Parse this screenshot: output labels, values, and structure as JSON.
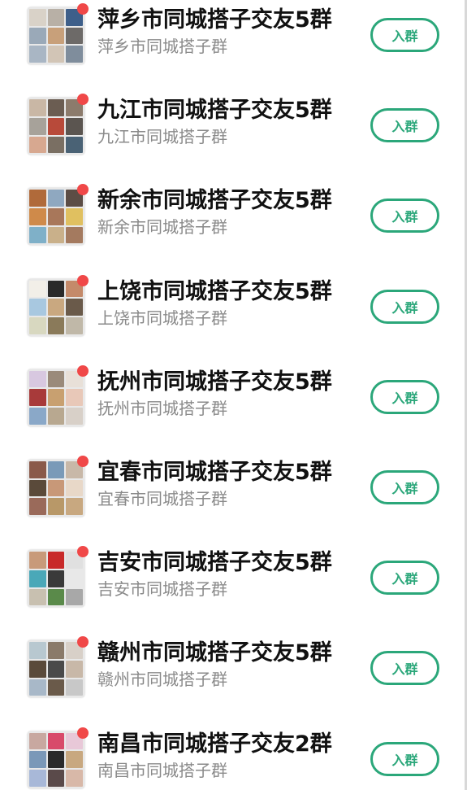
{
  "join_label": "入群",
  "groups": [
    {
      "title": "萍乡市同城搭子交友5群",
      "subtitle": "萍乡市同城搭子群",
      "tiles": [
        "#d9d2c8",
        "#b8b0a6",
        "#3e5f8a",
        "#9aa9b8",
        "#c8a07a",
        "#6d6a68",
        "#a9b6c4",
        "#d2c5b6",
        "#7f8d9c"
      ]
    },
    {
      "title": "九江市同城搭子交友5群",
      "subtitle": "九江市同城搭子群",
      "tiles": [
        "#c9b7a5",
        "#6b5d52",
        "#8c7b6c",
        "#a7a29a",
        "#b84a3a",
        "#5b5550",
        "#d7a890",
        "#7a6f63",
        "#4a6275"
      ]
    },
    {
      "title": "新余市同城搭子交友5群",
      "subtitle": "新余市同城搭子群",
      "tiles": [
        "#b06a3a",
        "#8fa8c0",
        "#5c4d45",
        "#cf8a4a",
        "#a8775a",
        "#e0c060",
        "#7fb0c8",
        "#c9b08a",
        "#a47a5f"
      ]
    },
    {
      "title": "上饶市同城搭子交友5群",
      "subtitle": "上饶市同城搭子群",
      "tiles": [
        "#f2efe8",
        "#2a2a2a",
        "#c48a6a",
        "#a8c8e0",
        "#c9a880",
        "#6a5a4a",
        "#d8d8c0",
        "#8a7a5a",
        "#c0b8a8"
      ]
    },
    {
      "title": "抚州市同城搭子交友5群",
      "subtitle": "抚州市同城搭子群",
      "tiles": [
        "#d8c8e0",
        "#9a8a7a",
        "#e8e0d8",
        "#a83a3a",
        "#c8a070",
        "#e8c8b8",
        "#8aa8c8",
        "#b8a890",
        "#d8d0c8"
      ]
    },
    {
      "title": "宜春市同城搭子交友5群",
      "subtitle": "宜春市同城搭子群",
      "tiles": [
        "#8a5a4a",
        "#7a9ab8",
        "#c8b8a8",
        "#5a4a3a",
        "#c89878",
        "#e8d8c8",
        "#9a6a5a",
        "#b89868",
        "#c8a880"
      ]
    },
    {
      "title": "吉安市同城搭子交友5群",
      "subtitle": "吉安市同城搭子群",
      "tiles": [
        "#c89a7a",
        "#c82a2a",
        "#e0e0e0",
        "#4aa8b8",
        "#3a3a3a",
        "#e8e8e8",
        "#c8c0b0",
        "#5a8a4a",
        "#a8a8a8"
      ]
    },
    {
      "title": "赣州市同城搭子交友5群",
      "subtitle": "赣州市同城搭子群",
      "tiles": [
        "#b8c8d0",
        "#8a7a6a",
        "#d8d0c8",
        "#5a4a3a",
        "#4a4a4a",
        "#c8b8a8",
        "#a8b8c8",
        "#6a5a4a",
        "#c8c8c8"
      ]
    },
    {
      "title": "南昌市同城搭子交友2群",
      "subtitle": "南昌市同城搭子群",
      "tiles": [
        "#c8a8a0",
        "#d84a6a",
        "#e8c8d8",
        "#7a98b8",
        "#2a2a2a",
        "#c8a880",
        "#a8b8d8",
        "#5a4a4a",
        "#d8b8a8"
      ]
    }
  ]
}
